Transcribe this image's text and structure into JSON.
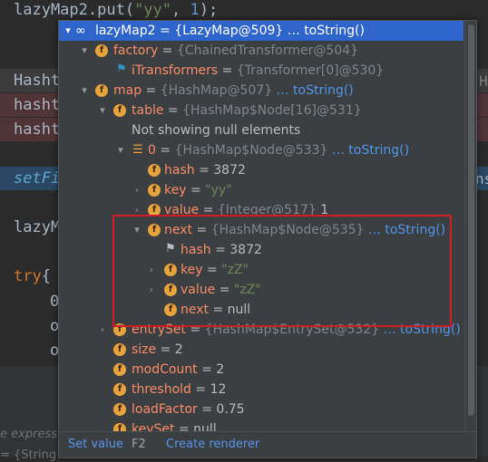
{
  "editor": {
    "line1": {
      "prefix": "lazyMap2.put(",
      "str": "\"yy\"",
      "sep": ", ",
      "num": "1",
      "suffix": ");"
    },
    "line_hasht1": "Hasht",
    "line_hasht2": "hasht",
    "line_hasht3": "hasht",
    "line_setfi": "setFi",
    "line_lazym": "lazyM",
    "line_try": "try",
    "line_try_brace": "{",
    "line_o1": "0",
    "line_o2": "o",
    "line_o3": "o",
    "right_h": "H",
    "right_ns": "ns",
    "bottom_text1": "e express",
    "bottom_text2": "= {String"
  },
  "popup": {
    "rows": [
      {
        "name": "lazyMap2",
        "eq": " = ",
        "val": "{LazyMap@509}",
        "link": " … toString()"
      },
      {
        "name": "factory",
        "eq": " = ",
        "val": "{ChainedTransformer@504}"
      },
      {
        "name": "iTransformers",
        "eq": " = ",
        "val": "{Transformer[0]@530}"
      },
      {
        "name": "map",
        "eq": " = ",
        "val": "{HashMap@507}",
        "link": " … toString()"
      },
      {
        "name": "table",
        "eq": " = ",
        "val": "{HashMap$Node[16]@531}"
      },
      {
        "text": "Not showing null elements"
      },
      {
        "name": "0",
        "eq": " = ",
        "val": "{HashMap$Node@533}",
        "link": " … toString()"
      },
      {
        "name": "hash",
        "eq": " = ",
        "valw": "3872"
      },
      {
        "name": "key",
        "eq": " = ",
        "valstr": "\"yy\""
      },
      {
        "name": "value",
        "eq": " = ",
        "val": "{Integer@517}",
        "valw": " 1"
      },
      {
        "name": "next",
        "eq": " = ",
        "val": "{HashMap$Node@535}",
        "link": " … toString()"
      },
      {
        "name": "hash",
        "eq": " = ",
        "valw": "3872"
      },
      {
        "name": "key",
        "eq": " = ",
        "valstr": "\"zZ\""
      },
      {
        "name": "value",
        "eq": " = ",
        "valstr": "\"zZ\""
      },
      {
        "name": "next",
        "eq": " = ",
        "valw": "null"
      },
      {
        "name": "entrySet",
        "eq": " = ",
        "val": "{HashMap$EntrySet@532}",
        "link": " … toString()"
      },
      {
        "name": "size",
        "eq": " = ",
        "valw": "2"
      },
      {
        "name": "modCount",
        "eq": " = ",
        "valw": "2"
      },
      {
        "name": "threshold",
        "eq": " = ",
        "valw": "12"
      },
      {
        "name": "loadFactor",
        "eq": " = ",
        "valw": "0.75"
      },
      {
        "name": "keySet",
        "eq": " = ",
        "valw": "null"
      }
    ],
    "footer": {
      "set_value": "Set value",
      "set_value_key": "F2",
      "create_renderer": "Create renderer"
    }
  },
  "icons": {
    "field": "f",
    "oo": "∞",
    "lines": "☰",
    "flag": "⚑",
    "expanded": "▾",
    "collapsed": "›"
  },
  "colors": {
    "selection": "#2f65ca",
    "field_name": "#f78c6c",
    "link": "#5394ec",
    "highlight_box": "#d01c25",
    "string": "#6a8759"
  }
}
